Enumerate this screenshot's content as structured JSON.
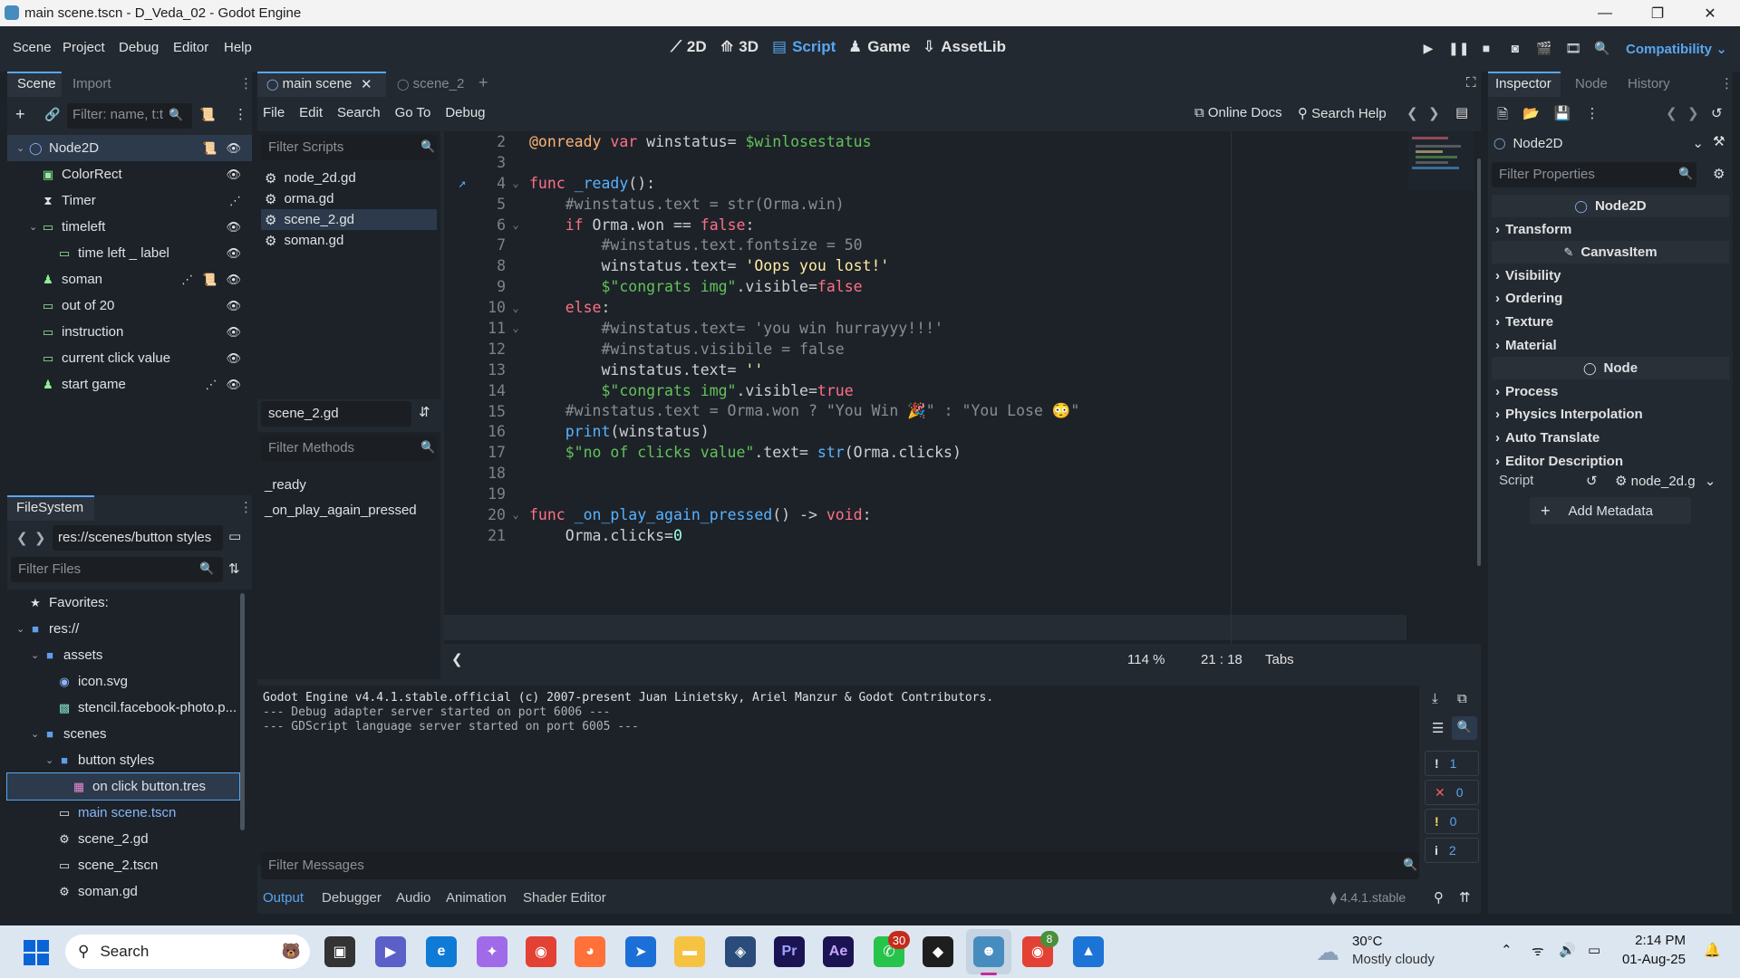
{
  "window": {
    "title": "main scene.tscn - D_Veda_02 - Godot Engine"
  },
  "menubar": {
    "menus": [
      "Scene",
      "Project",
      "Debug",
      "Editor",
      "Help"
    ],
    "workspaces": [
      "2D",
      "3D",
      "Script",
      "Game",
      "AssetLib"
    ],
    "active_workspace": "Script",
    "renderer": "Compatibility"
  },
  "scene_dock": {
    "tabs": [
      "Scene",
      "Import"
    ],
    "filter_placeholder": "Filter: name, t:t",
    "nodes": [
      {
        "name": "Node2D",
        "icon": "node2d-icon",
        "depth": 0
      },
      {
        "name": "ColorRect",
        "icon": "colorrect-icon",
        "depth": 1
      },
      {
        "name": "Timer",
        "icon": "timer-icon",
        "depth": 1
      },
      {
        "name": "timeleft",
        "icon": "label-icon",
        "depth": 1
      },
      {
        "name": "time left _ label",
        "icon": "label-icon",
        "depth": 2
      },
      {
        "name": "soman",
        "icon": "button-icon",
        "depth": 1
      },
      {
        "name": "out of 20",
        "icon": "label-icon",
        "depth": 1
      },
      {
        "name": "instruction",
        "icon": "label-icon",
        "depth": 1
      },
      {
        "name": "current click value",
        "icon": "label-icon",
        "depth": 1
      },
      {
        "name": "start game",
        "icon": "button-icon",
        "depth": 1
      }
    ]
  },
  "filesystem": {
    "tab": "FileSystem",
    "path": "res://scenes/button styles",
    "filter_placeholder": "Filter Files",
    "items": [
      {
        "name": "Favorites:",
        "type": "favorites",
        "depth": 0
      },
      {
        "name": "res://",
        "type": "folder",
        "depth": 0
      },
      {
        "name": "assets",
        "type": "folder",
        "depth": 1
      },
      {
        "name": "icon.svg",
        "type": "svg",
        "depth": 2
      },
      {
        "name": "stencil.facebook-photo.p...",
        "type": "image",
        "depth": 2
      },
      {
        "name": "scenes",
        "type": "folder",
        "depth": 1
      },
      {
        "name": "button styles",
        "type": "folder",
        "depth": 2
      },
      {
        "name": "on click button.tres",
        "type": "resource",
        "depth": 3
      },
      {
        "name": "main scene.tscn",
        "type": "scene",
        "depth": 2
      },
      {
        "name": "scene_2.gd",
        "type": "script",
        "depth": 2
      },
      {
        "name": "scene_2.tscn",
        "type": "scene",
        "depth": 2
      },
      {
        "name": "soman.gd",
        "type": "script",
        "depth": 2
      }
    ]
  },
  "editor_tabs": [
    "main scene",
    "scene_2"
  ],
  "script_menu": [
    "File",
    "Edit",
    "Search",
    "Go To",
    "Debug"
  ],
  "script_toolbar": {
    "online_docs": "Online Docs",
    "search_help": "Search Help"
  },
  "script_list": {
    "filter_placeholder": "Filter Scripts",
    "scripts": [
      "node_2d.gd",
      "orma.gd",
      "scene_2.gd",
      "soman.gd"
    ],
    "selected": "scene_2.gd",
    "current_name": "scene_2.gd",
    "methods_placeholder": "Filter Methods",
    "methods": [
      "_ready",
      "_on_play_again_pressed"
    ]
  },
  "code": {
    "lines": [
      {
        "n": "2",
        "html": "<span class='an'>@onready</span> <span class='kw'>var</span> winstatus= <span class='nd'>$winlosestatus</span>"
      },
      {
        "n": "3",
        "html": ""
      },
      {
        "n": "4",
        "html": "<span class='kw'>func</span> <span class='fn'>_ready</span>():"
      },
      {
        "n": "5",
        "html": "    <span class='cm'>#winstatus.text = str(Orma.win)</span>"
      },
      {
        "n": "6",
        "html": "    <span class='kw'>if</span> Orma.won == <span class='kw'>false</span>:"
      },
      {
        "n": "7",
        "html": "        <span class='cm'>#winstatus.text.fontsize = 50</span>"
      },
      {
        "n": "8",
        "html": "        winstatus.text= <span class='str'>'Oops you lost!'</span>"
      },
      {
        "n": "9",
        "html": "        <span class='nd'>$\"congrats img\"</span>.visible=<span class='kw'>false</span>"
      },
      {
        "n": "10",
        "html": "    <span class='kw'>else</span>:"
      },
      {
        "n": "11",
        "html": "        <span class='cm'>#winstatus.text= 'you win hurrayyy!!!'</span>"
      },
      {
        "n": "12",
        "html": "        <span class='cm'>#winstatus.visibile = false</span>"
      },
      {
        "n": "13",
        "html": "        winstatus.text= <span class='str'>''</span>"
      },
      {
        "n": "14",
        "html": "        <span class='nd'>$\"congrats img\"</span>.visible=<span class='kw'>true</span>"
      },
      {
        "n": "15",
        "html": "    <span class='cm'>#winstatus.text = Orma.won ? \"You Win 🎉\" : \"You Lose 😳\"</span>"
      },
      {
        "n": "16",
        "html": "    <span class='fn'>print</span>(winstatus)"
      },
      {
        "n": "17",
        "html": "    <span class='nd'>$\"no of clicks value\"</span>.text= <span class='fn'>str</span>(Orma.clicks)"
      },
      {
        "n": "18",
        "html": ""
      },
      {
        "n": "19",
        "html": ""
      },
      {
        "n": "20",
        "html": "<span class='kw'>func</span> <span class='fn'>_on_play_again_pressed</span>() -> <span class='kw'>void</span>:"
      },
      {
        "n": "21",
        "html": "    Orma.clicks=<span class='num'>0</span>"
      }
    ]
  },
  "status": {
    "zoom": "114 %",
    "line": "21",
    "col": "18",
    "indent": "Tabs"
  },
  "output": {
    "lines": [
      "Godot Engine v4.4.1.stable.official (c) 2007-present Juan Linietsky, Ariel Manzur & Godot Contributors.",
      "--- Debug adapter server started on port 6006 ---",
      "--- GDScript language server started on port 6005 ---"
    ],
    "filter_placeholder": "Filter Messages",
    "counters": [
      {
        "icon": "message-icon",
        "value": "1"
      },
      {
        "icon": "error-icon",
        "value": "0"
      },
      {
        "icon": "warning-icon",
        "value": "0"
      },
      {
        "icon": "info-icon",
        "value": "2"
      }
    ]
  },
  "bottom_tabs": [
    "Output",
    "Debugger",
    "Audio",
    "Animation",
    "Shader Editor"
  ],
  "version": "4.4.1.stable",
  "inspector": {
    "tabs": [
      "Inspector",
      "Node",
      "History"
    ],
    "object": "Node2D",
    "filter_placeholder": "Filter Properties",
    "sections": [
      {
        "type": "cat",
        "label": "Node2D"
      },
      {
        "type": "sec",
        "label": "Transform"
      },
      {
        "type": "cat",
        "label": "CanvasItem"
      },
      {
        "type": "sec",
        "label": "Visibility"
      },
      {
        "type": "sec",
        "label": "Ordering"
      },
      {
        "type": "sec",
        "label": "Texture"
      },
      {
        "type": "sec",
        "label": "Material"
      },
      {
        "type": "cat",
        "label": "Node"
      },
      {
        "type": "sec",
        "label": "Process"
      },
      {
        "type": "sec",
        "label": "Physics Interpolation"
      },
      {
        "type": "sec",
        "label": "Auto Translate"
      },
      {
        "type": "sec",
        "label": "Editor Description"
      }
    ],
    "script_label": "Script",
    "script_value": "node_2d.g",
    "add_metadata": "Add Metadata"
  },
  "taskbar": {
    "search": "Search",
    "weather_temp": "30°C",
    "weather_desc": "Mostly cloudy",
    "time": "2:14 PM",
    "date": "01-Aug-25",
    "whatsapp_badge": "30",
    "chrome_badge": "8"
  },
  "colors": {
    "accent": "#58a6f2",
    "keyword": "#ff7085",
    "string": "#ffeda1",
    "comment": "#898d93",
    "node_path": "#63c259"
  }
}
